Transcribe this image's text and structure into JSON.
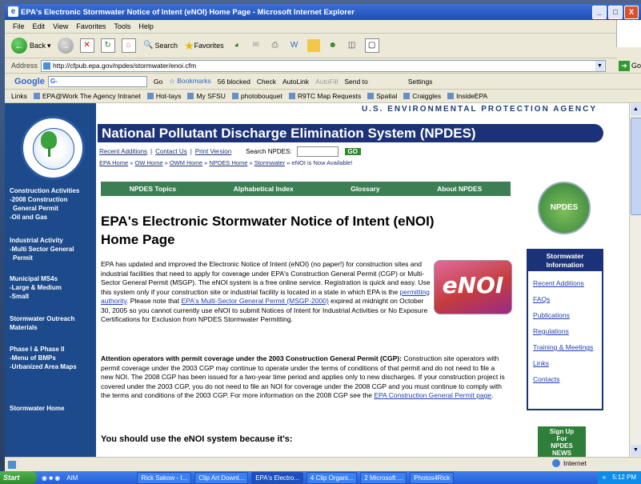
{
  "window": {
    "title": "EPA's Electronic Stormwater Notice of Intent (eNOI) Home Page - Microsoft Internet Explorer",
    "controls": [
      "_",
      "□",
      "X"
    ]
  },
  "menu": [
    "File",
    "Edit",
    "View",
    "Favorites",
    "Tools",
    "Help"
  ],
  "toolbar": {
    "back": "Back",
    "search": "Search",
    "favorites": "Favorites"
  },
  "address": {
    "label": "Address",
    "url": "http://cfpub.epa.gov/npdes/stormwater/enoi.cfm",
    "go": "Go"
  },
  "googlebar": {
    "logo": "Google",
    "placeholder": "G-",
    "items": [
      "Go",
      "Bookmarks",
      "56 blocked",
      "Check",
      "AutoLink",
      "AutoFill",
      "Send to",
      "Settings"
    ]
  },
  "links": {
    "label": "Links",
    "items": [
      "EPA@Work The Agency Intranet",
      "Hot-tays",
      "My SFSU",
      "photobouquet",
      "R9TC Map Requests",
      "Spatial",
      "Craiggles",
      "InsideEPA"
    ]
  },
  "page": {
    "agency": "U.S. ENVIRONMENTAL PROTECTION AGENCY",
    "banner": "National Pollutant Discharge Elimination System (NPDES)",
    "toplinks": [
      "Recent Additions",
      "Contact Us",
      "Print Version"
    ],
    "search_label": "Search NPDES:",
    "search_go": "GO",
    "breadcrumb": [
      "EPA Home",
      "OW Home",
      "OWM Home",
      "NPDES Home",
      "Stormwater"
    ],
    "breadcrumb_tail": "» eNOI is Now Available!",
    "topics": [
      "NPDES Topics",
      "Alphabetical Index",
      "Glossary",
      "About NPDES"
    ],
    "title_line1": "EPA's Electronic Stormwater Notice of Intent (eNOI)",
    "title_line2": "Home Page",
    "intro_a": "EPA has updated and improved the Electronic Notice of Intent (eNOI) (no paper!) for construction sites and industrial facilities that need to apply for coverage under EPA's Construction General Permit (CGP) or Multi-Sector General Permit (MSGP). The eNOI system is a free online service. Registration is quick and easy. Use this system only if your construction site or industrial facility is located in a state in which EPA is the ",
    "intro_link1": "permitting authority",
    "intro_b": ". Please note that ",
    "intro_link2": "EPA's Multi-Sector General Permit (MSGP-2000)",
    "intro_c": " expired at midnight on October 30, 2005 so you cannot currently use eNOI to submit Notices of Intent for Industrial Activities or No Exposure Certifications for Exclusion from NPDES Stormwater Permitting.",
    "attn_heading": "Attention operators with permit coverage under the 2003 Construction General Permit (CGP):",
    "attn_body": " Construction site operators with permit coverage under the 2003 CGP may continue to operate under the terms of conditions of that permit and do not need to file a new NOI. The 2008 CGP has been issued for a two-year time period and applies only to new discharges. If your construction project is covered under the 2003 CGP, you do not need to file an NOI for coverage under the 2008 CGP and you must continue to comply with the terms and conditions of the 2003 CGP. For more information on the 2008 CGP see the ",
    "attn_link": "EPA Construction General Permit page",
    "attn_end": ".",
    "should_use": "You should use the eNOI system because it's:",
    "enoi_logo": "eNOI",
    "npdes_badge": "NPDES",
    "sidebar_header": "Stormwater Information",
    "sidebar_links": [
      "Recent Additions",
      "FAQs",
      "Publications",
      "Regulations",
      "Training & Meetings",
      "Links",
      "Contacts"
    ],
    "signup": [
      "Sign Up",
      "For",
      "NPDES",
      "NEWS"
    ]
  },
  "leftnav": [
    [
      "Construction Activities",
      "-2008 Construction",
      "General Permit",
      "-Oil and Gas"
    ],
    [
      "Industrial Activity",
      "-Multi Sector General",
      "Permit"
    ],
    [
      "Municipal MS4s",
      "-Large & Medium",
      "-Small"
    ],
    [
      "Stormwater Outreach",
      "Materials"
    ],
    [
      "Phase I & Phase II",
      "-Menu of BMPs",
      "-Urbanized Area Maps"
    ],
    [
      "Stormwater Home"
    ]
  ],
  "status": {
    "zone": "Internet"
  },
  "taskbar": {
    "start": "Start",
    "tasks": [
      "AIM",
      "Rick Sakow - I...",
      "Clip Art Downl...",
      "EPA's Electro...",
      "4 Clip Organi...",
      "2 Microsoft ...",
      "Photos4Rick"
    ],
    "clock": "5:12 PM"
  }
}
